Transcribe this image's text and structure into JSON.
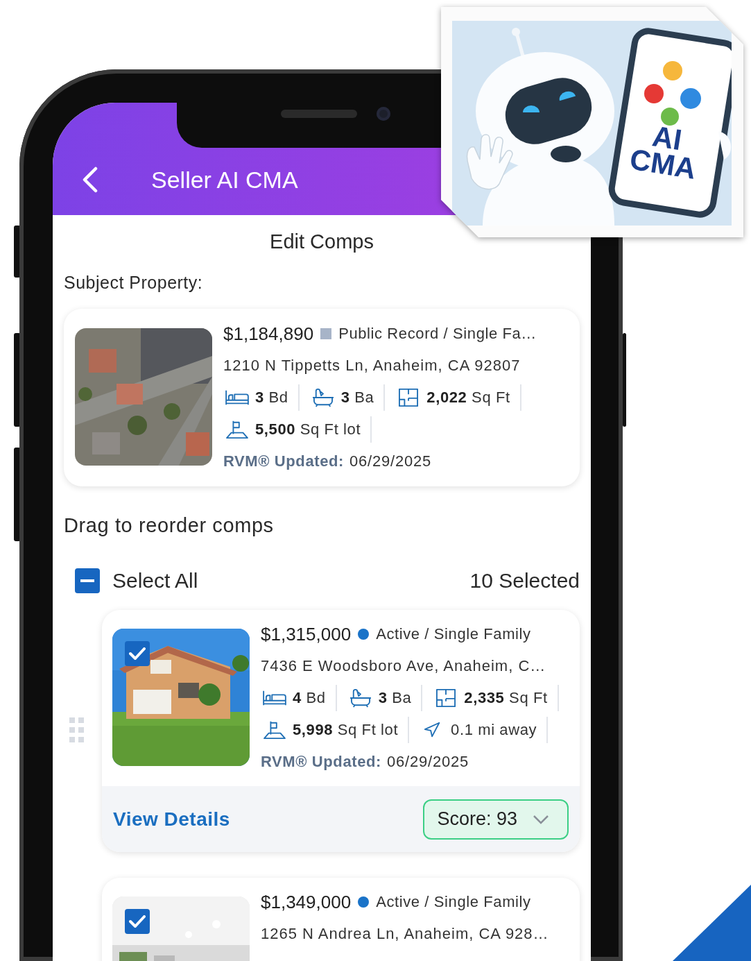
{
  "header": {
    "title": "Seller AI CMA"
  },
  "page_title": "Edit Comps",
  "subject_label": "Subject Property:",
  "subject": {
    "price": "$1,184,890",
    "status_marker": {
      "kind": "square",
      "color": "#a7b4c8"
    },
    "status": "Public Record / Single Fa…",
    "address": "1210 N Tippetts Ln, Anaheim, CA 92807",
    "stats": [
      {
        "kind": "beds",
        "text": "**3** Bd"
      },
      {
        "kind": "baths",
        "text": "**3** Ba"
      },
      {
        "kind": "area",
        "text": "**2,022** Sq Ft"
      },
      {
        "kind": "lot",
        "text": "**5,500** Sq Ft lot"
      }
    ],
    "rvm_label": "RVM® Updated:",
    "rvm_date": "06/29/2025"
  },
  "drag_hint": "Drag to reorder comps",
  "select_all": {
    "label": "Select All",
    "indeterminate": true
  },
  "selected_count": "10 Selected",
  "comps": [
    {
      "selected": true,
      "price": "$1,315,000",
      "status_marker": {
        "kind": "dot",
        "color": "#1a73c8"
      },
      "status": "Active / Single Family",
      "address": "7436 E Woodsboro Ave, Anaheim, C…",
      "stats": [
        {
          "kind": "beds",
          "text": "**4** Bd"
        },
        {
          "kind": "baths",
          "text": "**3** Ba"
        },
        {
          "kind": "area",
          "text": "**2,335** Sq Ft"
        },
        {
          "kind": "lot",
          "text": "**5,998** Sq Ft lot"
        },
        {
          "kind": "distance",
          "text": "0.1 mi away"
        }
      ],
      "rvm_label": "RVM® Updated:",
      "rvm_date": "06/29/2025",
      "details_link": "View Details",
      "score": "Score: 93"
    },
    {
      "selected": true,
      "price": "$1,349,000",
      "status_marker": {
        "kind": "dot",
        "color": "#1a73c8"
      },
      "status": "Active / Single Family",
      "address": "1265 N Andrea Ln, Anaheim, CA 928…"
    }
  ],
  "sticker": {
    "lines": [
      "AI",
      "CMA"
    ]
  }
}
